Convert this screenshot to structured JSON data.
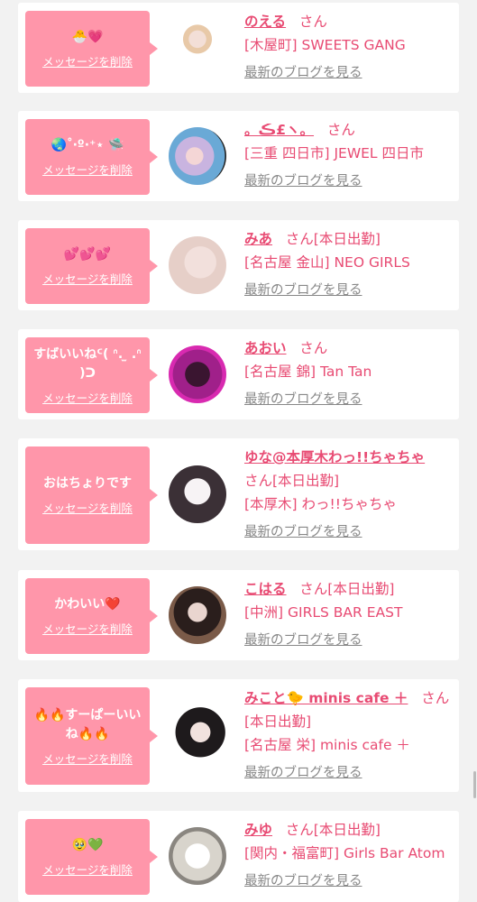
{
  "delete_label": "メッセージを削除",
  "blog_label": "最新のブログを見る",
  "colors": {
    "bubble": "#ff96aa",
    "name": "#e84b73",
    "link_gray": "#888888",
    "background": "#f2f2f2"
  },
  "items": [
    {
      "message": "🐣💗",
      "name": "のえる",
      "suffix": "さん",
      "lines": [
        "[木屋町] SWEETS GANG"
      ]
    },
    {
      "message": "🌏˚‧º·⁺⋆ 🛸",
      "name": "。ڪ£ヽ。",
      "suffix": "さん",
      "lines": [
        "[三重 四日市] JEWEL 四日市"
      ]
    },
    {
      "message": "💕💕💕",
      "name": "みあ",
      "suffix": "さん[本日出勤]",
      "lines": [
        "[名古屋 金山] NEO GIRLS"
      ]
    },
    {
      "message": "すばいいねᑦ( ᐢ. ̫ .ᐢ )ᑐ",
      "name": "あおい",
      "suffix": "さん",
      "lines": [
        "[名古屋 錦] Tan Tan"
      ]
    },
    {
      "message": "おはちょりです",
      "name": "ゆな@本厚木わっ!!ちゃちゃ",
      "suffix": "さん[本日出勤]",
      "lines": [
        "[本厚木] わっ!!ちゃちゃ"
      ]
    },
    {
      "message": "かわいい❤️",
      "name": "こはる",
      "suffix": "さん[本日出勤]",
      "lines": [
        "[中洲] GIRLS BAR EAST"
      ]
    },
    {
      "message": "🔥🔥すーぱーいいね🔥🔥",
      "name": "みこと🐤 minis cafe ＋",
      "suffix": "さん",
      "lines": [
        "[本日出勤]",
        "[名古屋 栄] minis cafe ＋"
      ]
    },
    {
      "message": "🥹💚",
      "name": "みゆ",
      "suffix": "さん[本日出勤]",
      "lines": [
        "[関内・福富町] Girls Bar Atom"
      ]
    }
  ]
}
